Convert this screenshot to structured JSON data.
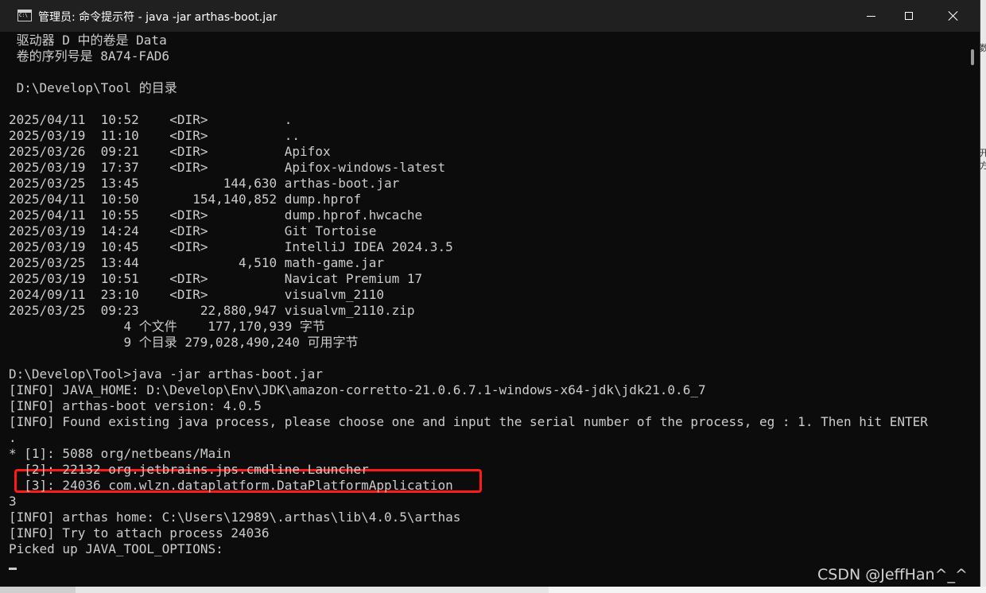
{
  "window": {
    "title": "管理员: 命令提示符 - java  -jar arthas-boot.jar",
    "icon": "cmd-icon",
    "controls": [
      "minimize-icon",
      "maximize-icon",
      "close-icon"
    ]
  },
  "console": {
    "lines": [
      " 驱动器 D 中的卷是 Data",
      " 卷的序列号是 8A74-FAD6",
      "",
      " D:\\Develop\\Tool 的目录",
      "",
      "2025/04/11  10:52    <DIR>          .",
      "2025/03/19  11:10    <DIR>          ..",
      "2025/03/26  09:21    <DIR>          Apifox",
      "2025/03/19  17:37    <DIR>          Apifox-windows-latest",
      "2025/03/25  13:45           144,630 arthas-boot.jar",
      "2025/04/11  10:50       154,140,852 dump.hprof",
      "2025/04/11  10:55    <DIR>          dump.hprof.hwcache",
      "2025/03/19  14:24    <DIR>          Git Tortoise",
      "2025/03/19  10:45    <DIR>          IntelliJ IDEA 2024.3.5",
      "2025/03/25  13:44             4,510 math-game.jar",
      "2025/03/19  10:51    <DIR>          Navicat Premium 17",
      "2024/09/11  23:10    <DIR>          visualvm_2110",
      "2025/03/25  09:23        22,880,947 visualvm_2110.zip",
      "               4 个文件    177,170,939 字节",
      "               9 个目录 279,028,490,240 可用字节",
      "",
      "D:\\Develop\\Tool>java -jar arthas-boot.jar",
      "[INFO] JAVA_HOME: D:\\Develop\\Env\\JDK\\amazon-corretto-21.0.6.7.1-windows-x64-jdk\\jdk21.0.6_7",
      "[INFO] arthas-boot version: 4.0.5",
      "[INFO] Found existing java process, please choose one and input the serial number of the process, eg : 1. Then hit ENTER",
      ".",
      "* [1]: 5088 org/netbeans/Main",
      "  [2]: 22132 org.jetbrains.jps.cmdline.Launcher",
      "  [3]: 24036 com.wlzn.dataplatform.DataPlatformApplication",
      "3",
      "[INFO] arthas home: C:\\Users\\12989\\.arthas\\lib\\4.0.5\\arthas",
      "[INFO] Try to attach process 24036",
      "Picked up JAVA_TOOL_OPTIONS:"
    ]
  },
  "right_edge_fragments": [
    "数",
    "开",
    "方"
  ],
  "watermark": "CSDN @JeffHan^_^",
  "colors": {
    "console_bg": "#0c0c0c",
    "console_text": "#cccccc",
    "titlebar_bg": "#202020",
    "highlight": "#ff1a1a"
  }
}
